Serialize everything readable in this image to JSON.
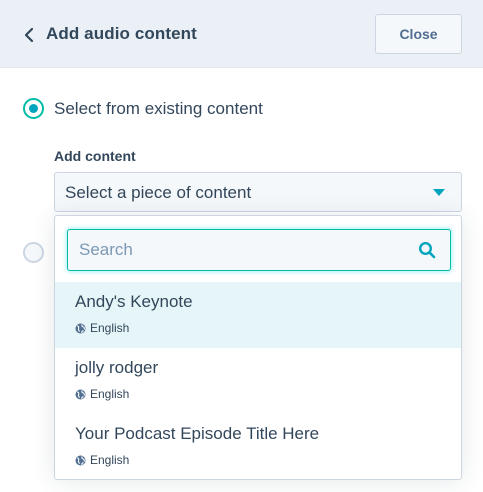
{
  "header": {
    "title": "Add audio content",
    "close_label": "Close"
  },
  "form": {
    "option_existing_label": "Select from existing content",
    "option_existing_selected": true,
    "field_label": "Add content",
    "select_value": "Select a piece of content"
  },
  "dropdown": {
    "search_placeholder": "Search",
    "search_value": "",
    "options": [
      {
        "title": "Andy's Keynote",
        "language": "English",
        "highlighted": true
      },
      {
        "title": "jolly rodger",
        "language": "English",
        "highlighted": false
      },
      {
        "title": "Your Podcast Episode Title Here",
        "language": "English",
        "highlighted": false
      }
    ]
  },
  "icons": {
    "back": "chevron-left-icon",
    "caret": "caret-down-icon",
    "search": "search-icon",
    "language": "globe-icon"
  },
  "colors": {
    "accent_teal": "#00a4bd",
    "focus_border": "#00bda5",
    "header_bg": "#eaf0f6",
    "highlight_bg": "#e5f5f8",
    "text": "#33475b"
  }
}
